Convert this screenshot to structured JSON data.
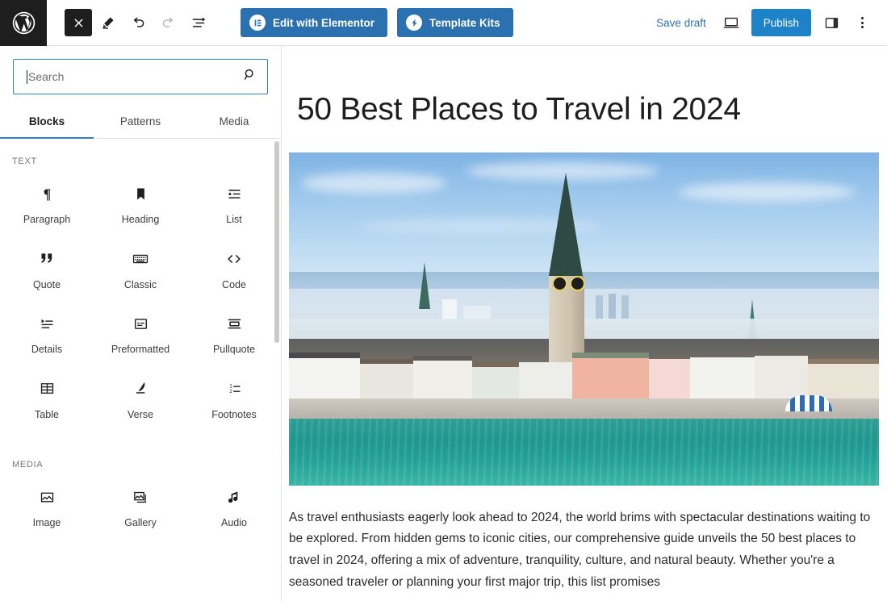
{
  "toolbar": {
    "logo_icon": "wordpress-logo-icon",
    "left_icons": [
      {
        "name": "close-icon",
        "glyph": "✕",
        "state": "active-dark"
      },
      {
        "name": "edit-pencil-icon",
        "glyph": "pencil",
        "state": "default"
      },
      {
        "name": "undo-icon",
        "glyph": "undo",
        "state": "default"
      },
      {
        "name": "redo-icon",
        "glyph": "redo",
        "state": "disabled"
      },
      {
        "name": "document-overview-icon",
        "glyph": "list-view",
        "state": "default"
      }
    ],
    "elementor_button": {
      "label": "Edit with Elementor",
      "icon": "elementor-icon",
      "color": "#2b71b0"
    },
    "template_kits_button": {
      "label": "Template Kits",
      "icon": "template-kits-icon",
      "color": "#2b71b0"
    },
    "save_draft_label": "Save draft",
    "preview_icon": "desktop-preview-icon",
    "publish_label": "Publish",
    "publish_color": "#1d82c7",
    "settings_sidebar_icon": "settings-panel-icon",
    "options_icon": "three-dots-menu-icon"
  },
  "inserter": {
    "search": {
      "value": "",
      "placeholder": "Search",
      "icon": "search-icon",
      "focused": true
    },
    "tabs": [
      {
        "label": "Blocks",
        "active": true
      },
      {
        "label": "Patterns",
        "active": false
      },
      {
        "label": "Media",
        "active": false
      }
    ],
    "categories": [
      {
        "label": "TEXT",
        "blocks": [
          {
            "label": "Paragraph",
            "icon": "paragraph-icon"
          },
          {
            "label": "Heading",
            "icon": "heading-icon"
          },
          {
            "label": "List",
            "icon": "list-icon"
          },
          {
            "label": "Quote",
            "icon": "quote-icon"
          },
          {
            "label": "Classic",
            "icon": "classic-icon"
          },
          {
            "label": "Code",
            "icon": "code-icon"
          },
          {
            "label": "Details",
            "icon": "details-icon"
          },
          {
            "label": "Preformatted",
            "icon": "preformatted-icon"
          },
          {
            "label": "Pullquote",
            "icon": "pullquote-icon"
          },
          {
            "label": "Table",
            "icon": "table-icon"
          },
          {
            "label": "Verse",
            "icon": "verse-icon"
          },
          {
            "label": "Footnotes",
            "icon": "footnotes-icon"
          }
        ]
      },
      {
        "label": "MEDIA",
        "blocks": [
          {
            "label": "Image",
            "icon": "image-icon"
          },
          {
            "label": "Gallery",
            "icon": "gallery-icon"
          },
          {
            "label": "Audio",
            "icon": "audio-icon"
          }
        ]
      }
    ]
  },
  "editor": {
    "post_title": "50 Best Places to Travel in 2024",
    "featured_image": {
      "name": "zurich-cityscape-image",
      "alt": "Aerial view of Zurich old town with St. Peter church clock tower and the turquoise Limmat river"
    },
    "paragraph": "As travel enthusiasts eagerly look ahead to 2024, the world brims with spectacular destinations waiting to be explored. From hidden gems to iconic cities, our comprehensive guide unveils the 50 best places to travel in 2024, offering a mix of adventure, tranquility, culture, and natural beauty. Whether you're a seasoned traveler or planning your first major trip, this list promises"
  },
  "colors": {
    "accent_blue": "#2b71b0",
    "publish_blue": "#1d82c7",
    "focus_border": "#3582b6",
    "dark": "#1e1e1e",
    "border": "#e0e0e0"
  }
}
